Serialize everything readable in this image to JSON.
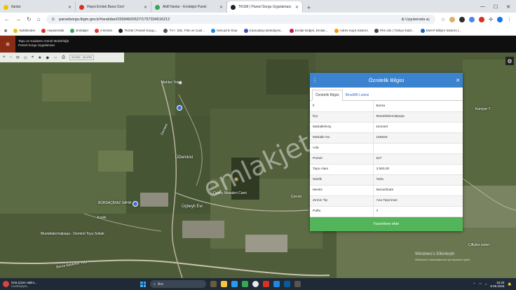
{
  "browser": {
    "tabs": [
      {
        "label": "İlanlar",
        "color": "#f2c200"
      },
      {
        "label": "Hepsi Emlak Bana Özel",
        "color": "#d93025"
      },
      {
        "label": "Aktif İlanlar - Emlakjet Panel",
        "color": "#3aa657"
      },
      {
        "label": "TKGM | Parsel Sorgu Uygulaması",
        "color": "#222222",
        "active": true
      }
    ],
    "url": "parselsorgu.tkgm.gov.tr/#ara/idari/155946/0/627/1757334516212",
    "url_chip": "Uygulamada aç",
    "bookmarks": [
      "Sahibinden",
      "Hepsiemlak",
      "Emlakjet",
      "e-Devlet",
      "TKGM | Parsel Sorgu...",
      "TV+: Dizi, Film ve Canl...",
      "Netcad E-İmar",
      "Karacabey Belediyesi...",
      "Emlak Değeri, Emlak...",
      "Adres Kayıt Sistemi",
      "Film izle | Türkçe Dubl...",
      "EMAP Bilişim Sistemi |..."
    ]
  },
  "app": {
    "brand_line1": "Tapu ve Kadastro Genel Müdürlüğü",
    "brand_line2": "Parsel Sorgu Uygulaması"
  },
  "map": {
    "coords": "40.0301 , 28.4784",
    "labels": {
      "label1": "Mahlec Yolu",
      "label2": "Demirel",
      "label3": "ÜDemirel",
      "label4": "Kumyer T",
      "label5": "Ozbey Mazaleri Cami",
      "label6": "Üçbeyli Evi",
      "label7": "Çorum",
      "label8": "BÜRSAÇİRAZ SAHA",
      "label9": "Azalık",
      "label10": "Mustafakemalpaşa - Demirel Toyu Sokak",
      "label11": "Bursa Balıkesir Yolu",
      "label12": "Çiftçiler evleri"
    }
  },
  "panel": {
    "title": "Öznitelik Bilgisi",
    "tabs": [
      "Öznitelik Bilgisi",
      "Bina/BB Listesi"
    ],
    "rows": [
      {
        "key": "İl",
        "value": "Bursa"
      },
      {
        "key": "İlçe",
        "value": "Mustafakemalpaşa"
      },
      {
        "key": "Mahalle/Köy",
        "value": "Demirel"
      },
      {
        "key": "Mahalle No",
        "value": "155946"
      },
      {
        "key": "Ada",
        "value": ""
      },
      {
        "key": "Parsel",
        "value": "627"
      },
      {
        "key": "Tapu Alanı",
        "value": "3.550,00"
      },
      {
        "key": "Nitelik",
        "value": "Tarla"
      },
      {
        "key": "Mevkii",
        "value": "Mezarlıkatlı"
      },
      {
        "key": "Zemin Tip",
        "value": "Ana Taşınmaz"
      },
      {
        "key": "Pafta",
        "value": "4"
      }
    ],
    "button": "Favorilere ekle"
  },
  "watermark": "emlakjet.com",
  "windows_activation": {
    "line1": "Windows'u Etkinleştir",
    "line2": "Windows'u etkinleştirmek için Ayarlar'a gidin."
  },
  "taskbar": {
    "weather_line1": "Orta Çizen Haliro...",
    "weather_line2": "Cumhuriyet...",
    "search": "Ara",
    "time": "15:20",
    "date": "8.09.2025"
  }
}
